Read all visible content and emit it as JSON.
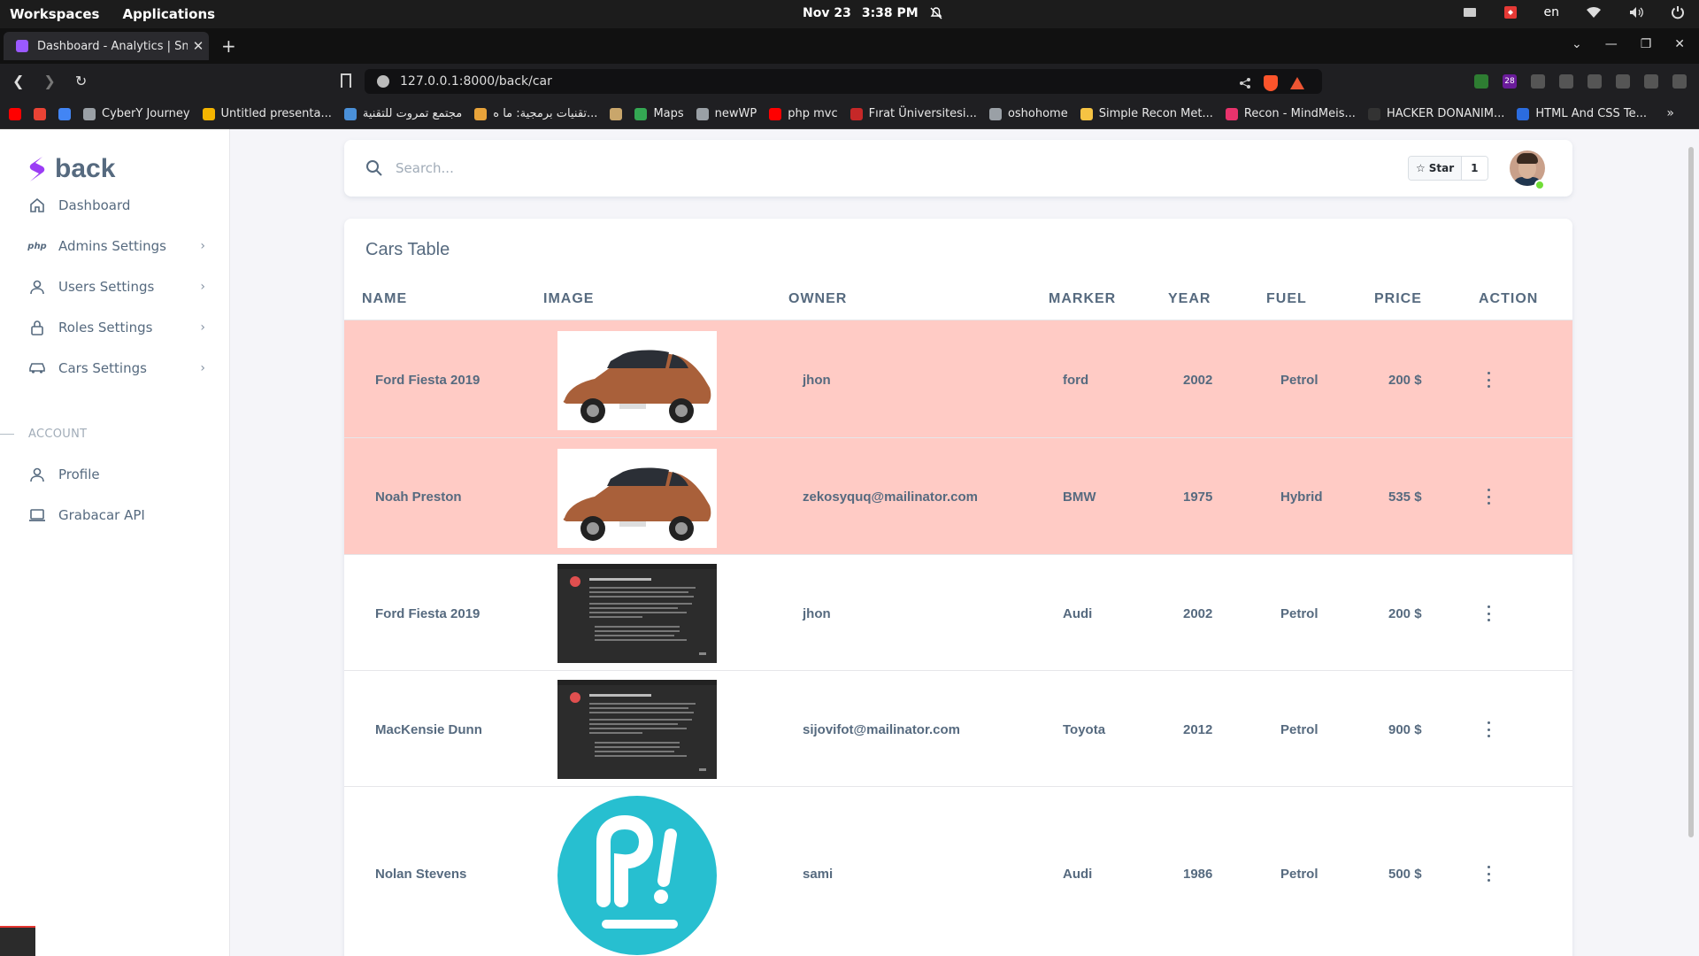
{
  "os": {
    "workspaces": "Workspaces",
    "applications": "Applications",
    "date": "Nov 23",
    "time": "3:38 PM",
    "lang": "en"
  },
  "browser": {
    "tab_title": "Dashboard - Analytics | Sne",
    "url": "127.0.0.1:8000/back/car",
    "ext_badge": "28",
    "bookmarks": [
      {
        "label": "",
        "icon": "youtube-icon",
        "color": "#ff0000"
      },
      {
        "label": "",
        "icon": "gmail-icon",
        "color": "#ea4335"
      },
      {
        "label": "",
        "icon": "translate-icon",
        "color": "#4285f4"
      },
      {
        "label": "CyberY Journey",
        "icon": "globe-icon",
        "color": "#9aa0a6"
      },
      {
        "label": "Untitled presenta...",
        "icon": "slides-icon",
        "color": "#f4b400"
      },
      {
        "label": "مجتمع تمروت للتقنية",
        "icon": "site-icon",
        "color": "#4a90d9"
      },
      {
        "label": "تقنيات برمجية: ما ه...",
        "icon": "site-icon",
        "color": "#e8a33a"
      },
      {
        "label": "",
        "icon": "site-icon",
        "color": "#c9a66b"
      },
      {
        "label": "Maps",
        "icon": "maps-icon",
        "color": "#34a853"
      },
      {
        "label": "newWP",
        "icon": "folder-icon",
        "color": "#9aa0a6"
      },
      {
        "label": "php mvc",
        "icon": "youtube-icon",
        "color": "#ff0000"
      },
      {
        "label": "Fırat Üniversitesi...",
        "icon": "university-icon",
        "color": "#c62828"
      },
      {
        "label": "oshohome",
        "icon": "globe-icon",
        "color": "#9aa0a6"
      },
      {
        "label": "Simple Recon Met...",
        "icon": "emoji-icon",
        "color": "#f6c343"
      },
      {
        "label": "Recon - MindMeis...",
        "icon": "mindmeister-icon",
        "color": "#e8336c"
      },
      {
        "label": "HACKER DONANIM...",
        "icon": "site-icon",
        "color": "#333333"
      },
      {
        "label": "HTML And CSS Te...",
        "icon": "e-icon",
        "color": "#2b6cdf"
      }
    ]
  },
  "sidebar": {
    "brand": "back",
    "items": [
      {
        "label": "Dashboard",
        "icon": "home-icon",
        "chevron": false
      },
      {
        "label": "Admins Settings",
        "icon": "php-icon",
        "chevron": true
      },
      {
        "label": "Users Settings",
        "icon": "user-icon",
        "chevron": true
      },
      {
        "label": "Roles Settings",
        "icon": "lock-icon",
        "chevron": true
      },
      {
        "label": "Cars Settings",
        "icon": "car-icon",
        "chevron": true
      }
    ],
    "section": "ACCOUNT",
    "account_items": [
      {
        "label": "Profile",
        "icon": "user-icon"
      },
      {
        "label": "Grabacar API",
        "icon": "laptop-icon"
      }
    ]
  },
  "navbar": {
    "search_placeholder": "Search...",
    "star_label": "Star",
    "star_count": "1"
  },
  "table": {
    "title": "Cars Table",
    "headers": [
      "NAME",
      "IMAGE",
      "OWNER",
      "MARKER",
      "YEAR",
      "FUEL",
      "PRICE",
      "ACTION"
    ],
    "rows": [
      {
        "name": "Ford Fiesta 2019",
        "image": "car-photo",
        "owner": "jhon",
        "marker": "ford",
        "year": "2002",
        "fuel": "Petrol",
        "price": "200 $",
        "highlight": true
      },
      {
        "name": "Noah Preston",
        "image": "car-photo",
        "owner": "zekosyquq@mailinator.com",
        "marker": "BMW",
        "year": "1975",
        "fuel": "Hybrid",
        "price": "535 $",
        "highlight": true
      },
      {
        "name": "Ford Fiesta 2019",
        "image": "error-screenshot",
        "owner": "jhon",
        "marker": "Audi",
        "year": "2002",
        "fuel": "Petrol",
        "price": "200 $",
        "highlight": false
      },
      {
        "name": "MacKensie Dunn",
        "image": "error-screenshot",
        "owner": "sijovifot@mailinator.com",
        "marker": "Toyota",
        "year": "2012",
        "fuel": "Petrol",
        "price": "900 $",
        "highlight": false
      },
      {
        "name": "Nolan Stevens",
        "image": "popos-logo",
        "owner": "sami",
        "marker": "Audi",
        "year": "1986",
        "fuel": "Petrol",
        "price": "500 $",
        "highlight": false
      }
    ]
  },
  "colors": {
    "brand_purple": "#9b3cf5",
    "row_highlight": "#ffcbc5",
    "text": "#566a7f",
    "popos_teal": "#27bfd0"
  }
}
